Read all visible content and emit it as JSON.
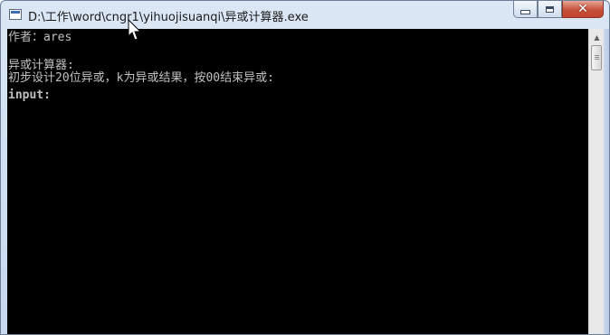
{
  "window": {
    "title": "D:\\工作\\word\\cngr1\\yihuojisuanqi\\异或计算器.exe",
    "icons": {
      "app": "console-app-icon",
      "minimize": "minimize-icon",
      "maximize": "maximize-icon",
      "close": "close-icon",
      "close_glyph": "✕"
    },
    "colors": {
      "console_background": "#000000",
      "console_text": "#c0c0c0",
      "close_button": "#c7503a"
    }
  },
  "console": {
    "lines": [
      "作者：ares",
      "",
      "异或计算器:",
      "初步设计20位异或，k为异或结果，按00结束异或:",
      "input:"
    ]
  },
  "scrollbar": {
    "up_arrow": "▲"
  }
}
